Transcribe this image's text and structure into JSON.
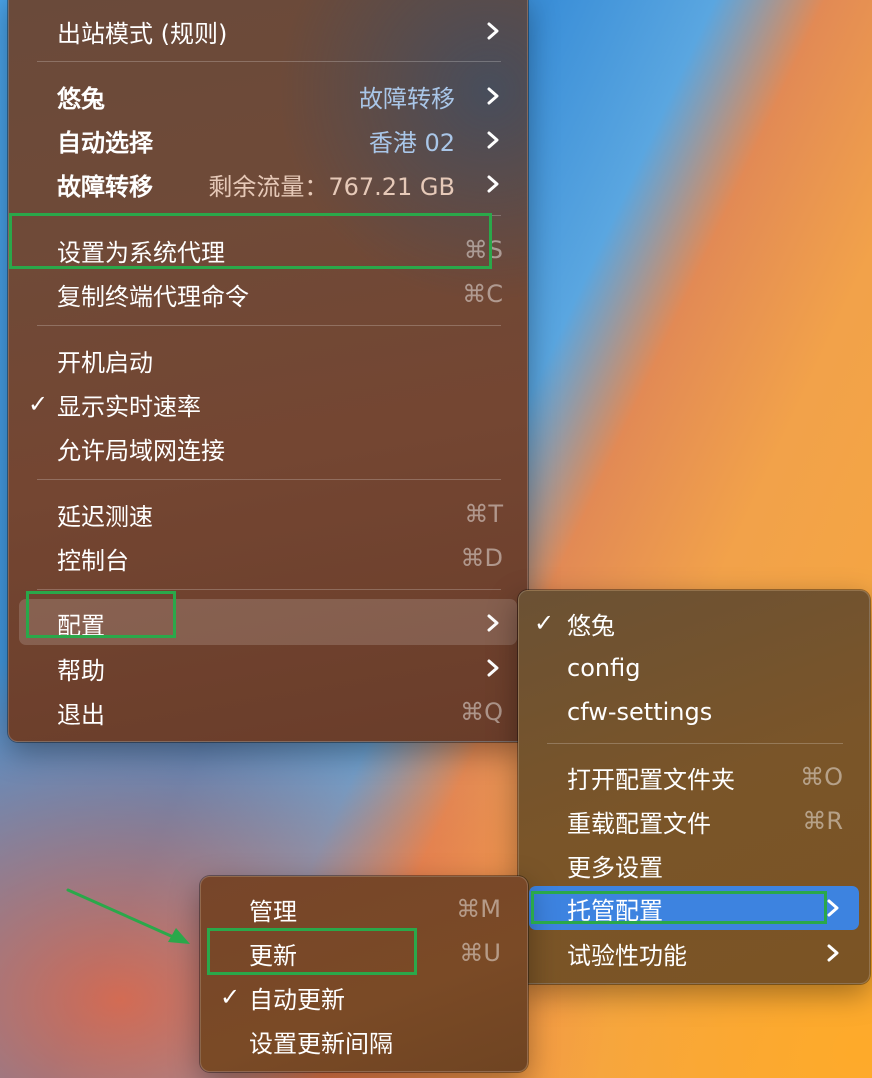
{
  "main_menu": {
    "outbound_mode": "出站模式 (规则)",
    "proxy_youtu": {
      "label": "悠兔",
      "value": "故障转移"
    },
    "auto_select": {
      "label": "自动选择",
      "value": "香港 02"
    },
    "failover": {
      "label": "故障转移",
      "value": "剩余流量：767.21 GB"
    },
    "set_system_proxy": {
      "label": "设置为系统代理",
      "shortcut": "⌘S"
    },
    "copy_terminal_cmd": {
      "label": "复制终端代理命令",
      "shortcut": "⌘C"
    },
    "launch_at_login": "开机启动",
    "show_speed": "显示实时速率",
    "allow_lan": "允许局域网连接",
    "latency_test": {
      "label": "延迟测速",
      "shortcut": "⌘T"
    },
    "dashboard": {
      "label": "控制台",
      "shortcut": "⌘D"
    },
    "config": "配置",
    "help": "帮助",
    "quit": {
      "label": "退出",
      "shortcut": "⌘Q"
    }
  },
  "config_menu": {
    "profile_youtu": "悠兔",
    "profile_config": "config",
    "profile_cfw": "cfw-settings",
    "open_folder": {
      "label": "打开配置文件夹",
      "shortcut": "⌘O"
    },
    "reload": {
      "label": "重载配置文件",
      "shortcut": "⌘R"
    },
    "more_settings": "更多设置",
    "managed": "托管配置",
    "experimental": "试验性功能"
  },
  "managed_menu": {
    "manage": {
      "label": "管理",
      "shortcut": "⌘M"
    },
    "update": {
      "label": "更新",
      "shortcut": "⌘U"
    },
    "auto_update": "自动更新",
    "update_interval": "设置更新间隔"
  },
  "check_glyph": "✓",
  "colors": {
    "highlight": "#3d83e0",
    "annotation": "#2aa84a",
    "value_text": "#a9c6e8"
  }
}
